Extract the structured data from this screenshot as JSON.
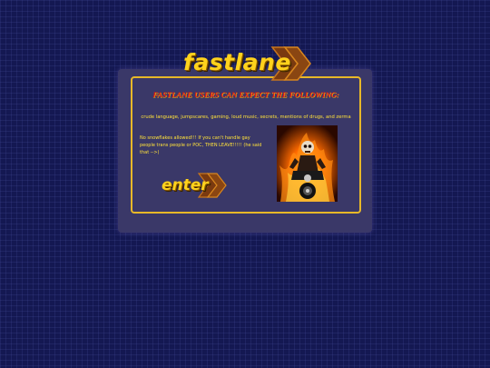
{
  "logo": {
    "text": "fastlane",
    "alt": "fastlane logo"
  },
  "headline": "FASTLANE USERS CAN EXPECT THE FOLLOWING:",
  "expectations": "crude language, jumpscares, gaming, loud music, secrets, mentions of drugs, and zerma",
  "warning": "No snowflakes allowed!!! If you can't handle gay people trans people or POC, THEN LEAVE!!!!! (he said that -->)",
  "enter_button": {
    "label": "enter"
  },
  "illustration": {
    "alt": "flaming skeleton biker on motorcycle"
  },
  "colors": {
    "background": "#141852",
    "panel": "#3a3868",
    "border": "#e8b828",
    "headline": "#e01818",
    "text": "#ffe23a",
    "logo": "#ffd21c"
  }
}
